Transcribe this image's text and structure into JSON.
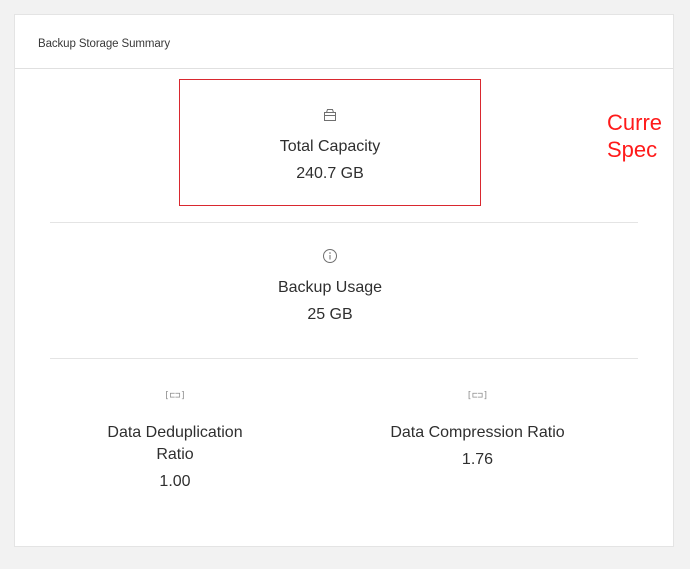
{
  "card": {
    "title": "Backup Storage Summary"
  },
  "metrics": {
    "total_capacity": {
      "icon": "storage-box-icon",
      "label": "Total Capacity",
      "value": "240.7 GB"
    },
    "backup_usage": {
      "icon": "info-icon",
      "label": "Backup Usage",
      "value": "25 GB"
    },
    "dedup_ratio": {
      "icon": "ratio-icon",
      "icon_text": "[⊏⊐]",
      "label_line1": "Data Deduplication",
      "label_line2": "Ratio",
      "value": "1.00"
    },
    "compression_ratio": {
      "icon": "ratio-icon",
      "icon_text": "[⊏⊐]",
      "label": "Data Compression Ratio",
      "value": "1.76"
    }
  },
  "annotation": {
    "line1": "Curre",
    "line2": "Spec",
    "color": "#ff1a1a"
  },
  "colors": {
    "highlight_border": "#d9282f",
    "background": "#f2f2f2",
    "card": "#ffffff"
  }
}
